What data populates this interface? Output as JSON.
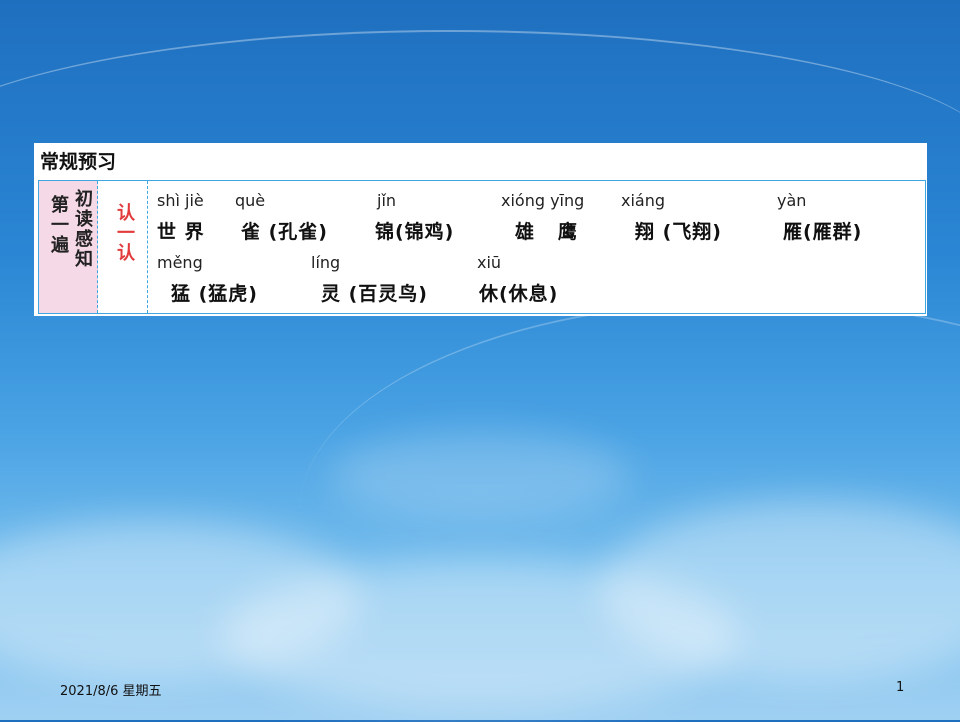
{
  "section_title": "常规预习",
  "col1_left": "第一遍",
  "col1_right": "初读感知",
  "col2": "认一认",
  "row1": {
    "pinyin": [
      "shì jiè",
      "què",
      "jǐn",
      "xióng yīng",
      "xiáng",
      "yàn"
    ],
    "chars": [
      "世 界",
      "雀 (孔雀)",
      "锦(锦鸡)",
      "雄   鹰",
      "翔 (飞翔)",
      "雁(雁群)"
    ]
  },
  "row2": {
    "pinyin": [
      "měng",
      "líng",
      "xiū"
    ],
    "chars": [
      "猛 (猛虎)",
      "灵 (百灵鸟)",
      "休(休息)"
    ]
  },
  "footer": {
    "date": "2021/8/6 星期五",
    "page": "1"
  }
}
